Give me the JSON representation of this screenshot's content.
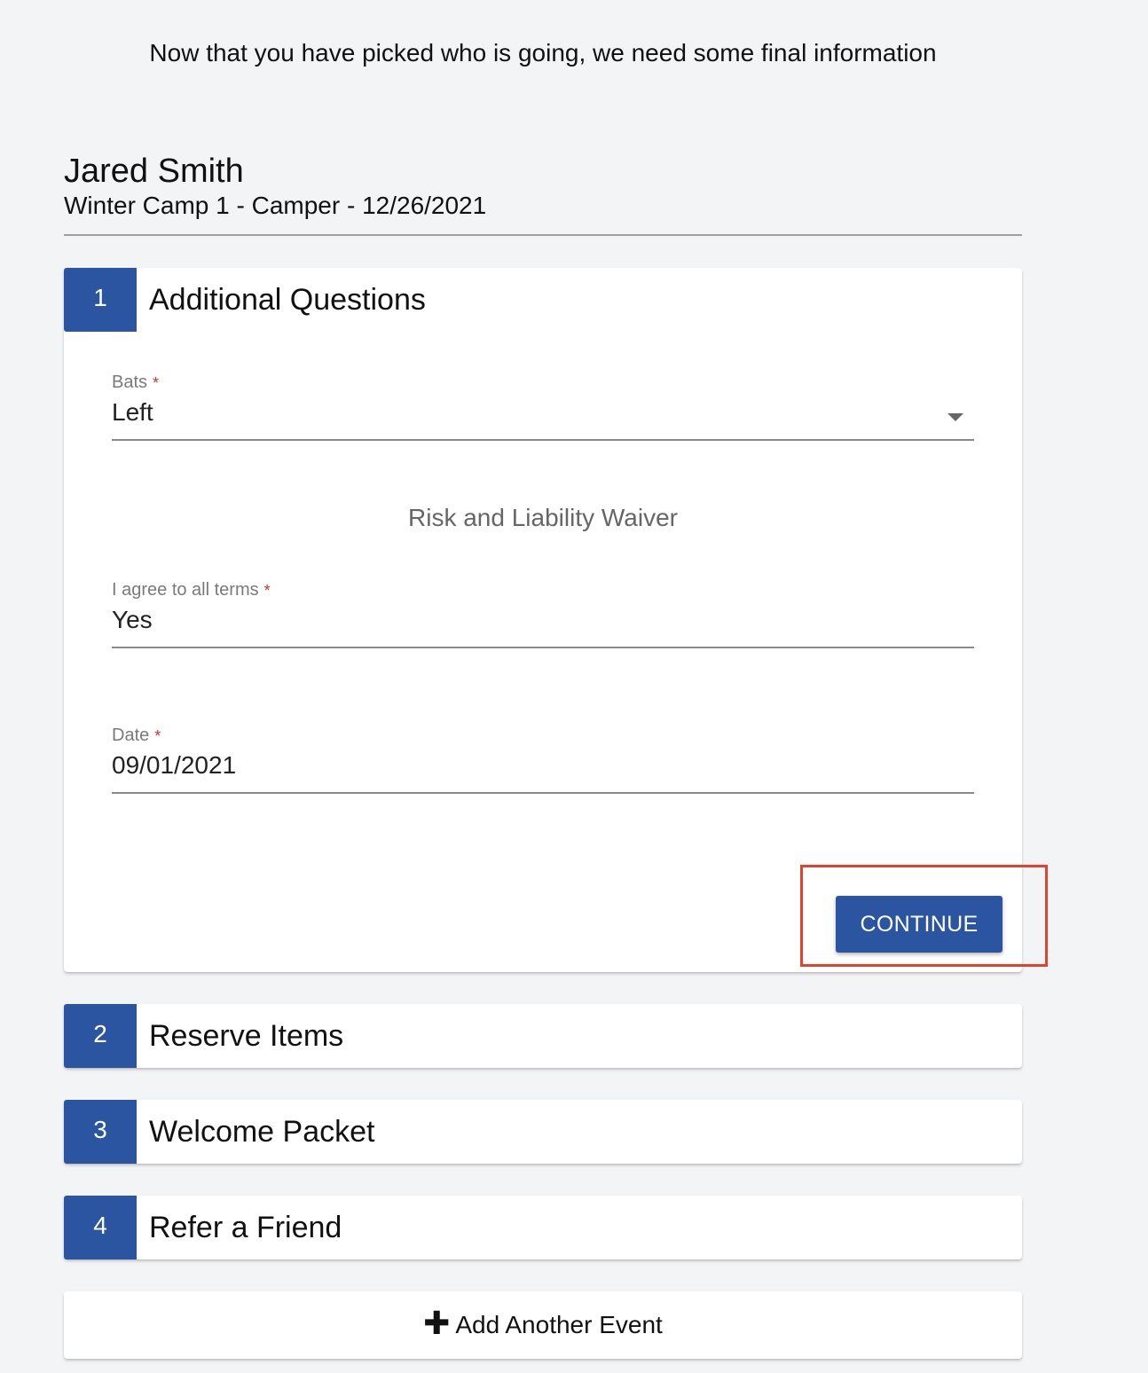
{
  "intro": "Now that you have picked who is going, we need some final information",
  "attendee": {
    "name": "Jared Smith",
    "event": "Winter Camp 1 - Camper - 12/26/2021"
  },
  "steps": [
    {
      "number": "1",
      "title": "Additional Questions"
    },
    {
      "number": "2",
      "title": "Reserve Items"
    },
    {
      "number": "3",
      "title": "Welcome Packet"
    },
    {
      "number": "4",
      "title": "Refer a Friend"
    }
  ],
  "form": {
    "bats": {
      "label": "Bats",
      "required_mark": "*",
      "value": "Left"
    },
    "waiver_heading": "Risk and Liability Waiver",
    "agree": {
      "label": "I agree to all terms",
      "required_mark": "*",
      "value": "Yes"
    },
    "date": {
      "label": "Date",
      "required_mark": "*",
      "value": "09/01/2021"
    },
    "continue_label": "CONTINUE"
  },
  "add_event": {
    "icon": "plus-icon",
    "label": "Add Another Event"
  },
  "colors": {
    "accent": "#2c55a1",
    "highlight": "#e0442e",
    "required": "#d32f2f",
    "background": "#f3f4f6"
  }
}
